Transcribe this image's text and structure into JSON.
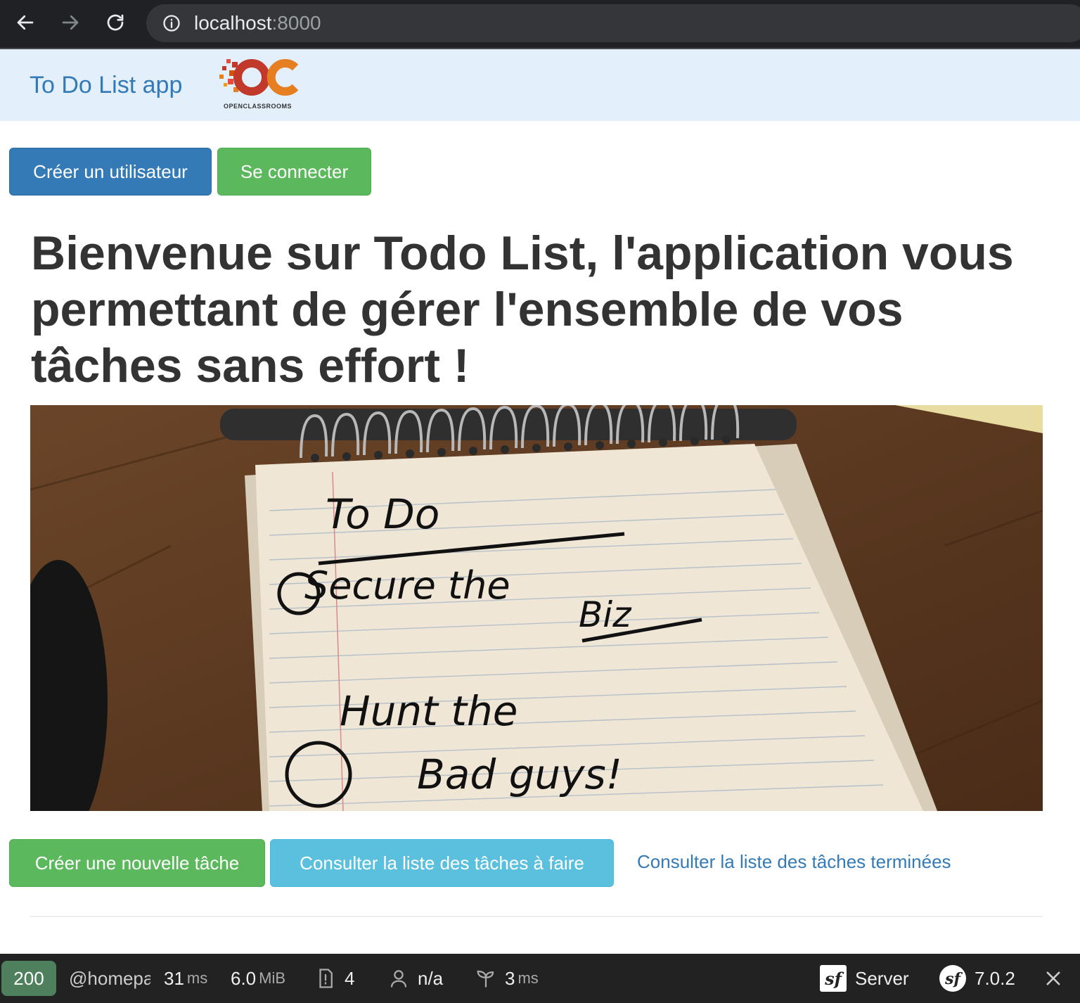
{
  "browser": {
    "url_host": "localhost",
    "url_port": ":8000"
  },
  "navbar": {
    "brand": "To Do List app",
    "logo_text": "OPENCLASSROOMS"
  },
  "actions_top": {
    "create_user": "Créer un utilisateur",
    "login": "Se connecter"
  },
  "main": {
    "title": "Bienvenue sur Todo List, l'application vous permettant de gérer l'ensemble de vos tâches sans effort !",
    "image_text": [
      "To Do",
      "Secure the",
      "Biz",
      "Hunt the",
      "Bad guys!"
    ]
  },
  "actions_bottom": {
    "new_task": "Créer une nouvelle tâche",
    "todo_list": "Consulter la liste des tâches à faire",
    "done_list": "Consulter la liste des tâches terminées"
  },
  "toolbar": {
    "status": "200",
    "route": "@homepa",
    "time_value": "31",
    "time_unit": "ms",
    "memory_value": "6.0",
    "memory_unit": "MiB",
    "logs_count": "4",
    "user": "n/a",
    "twig_value": "3",
    "twig_unit": "ms",
    "server": "Server",
    "version": "7.0.2"
  },
  "colors": {
    "primary": "#337ab7",
    "success": "#5cb85c",
    "info": "#5bc0de",
    "navbar_bg": "#e3f0fb",
    "toolbar_bg": "#222222",
    "status_bg": "#4f805d"
  }
}
